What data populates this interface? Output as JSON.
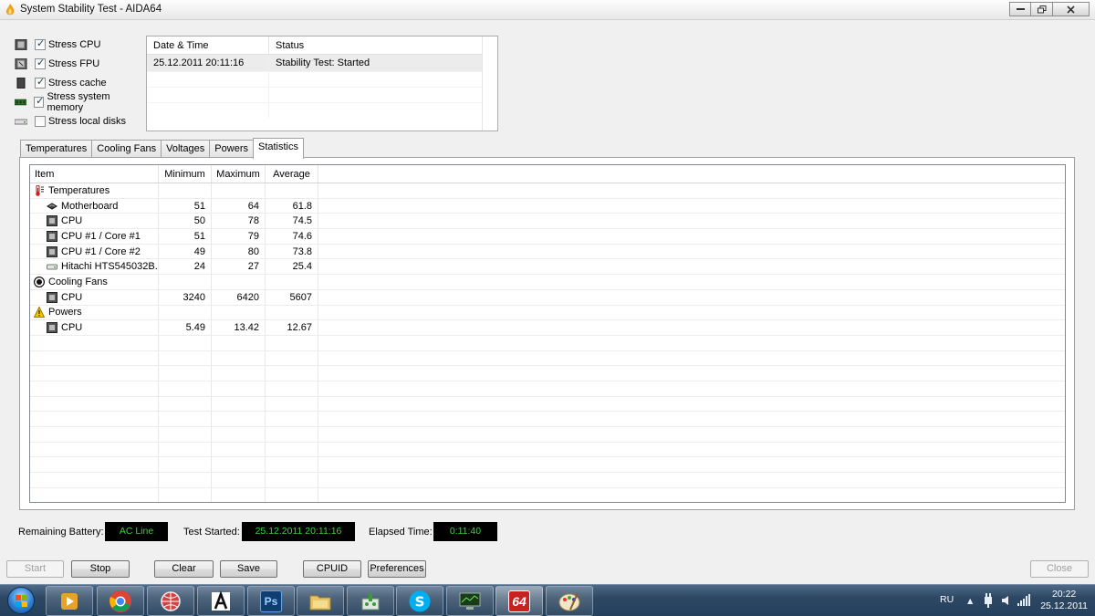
{
  "window": {
    "title": "System Stability Test - AIDA64",
    "controls": [
      "minimize",
      "maximize",
      "close"
    ]
  },
  "stress_options": [
    {
      "label": "Stress CPU",
      "checked": true,
      "icon": "cpu-chip-icon"
    },
    {
      "label": "Stress FPU",
      "checked": true,
      "icon": "fpu-chip-icon"
    },
    {
      "label": "Stress cache",
      "checked": true,
      "icon": "cache-chip-icon"
    },
    {
      "label": "Stress system memory",
      "checked": true,
      "icon": "memory-module-icon"
    },
    {
      "label": "Stress local disks",
      "checked": false,
      "icon": "hard-disk-icon"
    }
  ],
  "log": {
    "headers": {
      "datetime": "Date & Time",
      "status": "Status"
    },
    "rows": [
      {
        "datetime": "25.12.2011 20:11:16",
        "status": "Stability Test: Started"
      }
    ]
  },
  "tabs": [
    {
      "label": "Temperatures",
      "active": false
    },
    {
      "label": "Cooling Fans",
      "active": false
    },
    {
      "label": "Voltages",
      "active": false
    },
    {
      "label": "Powers",
      "active": false
    },
    {
      "label": "Statistics",
      "active": true
    }
  ],
  "stats": {
    "headers": {
      "item": "Item",
      "min": "Minimum",
      "max": "Maximum",
      "avg": "Average"
    },
    "rows": [
      {
        "level": 0,
        "icon": "thermometer-icon",
        "item": "Temperatures",
        "min": "",
        "max": "",
        "avg": ""
      },
      {
        "level": 1,
        "icon": "motherboard-icon",
        "item": "Motherboard",
        "min": "51",
        "max": "64",
        "avg": "61.8"
      },
      {
        "level": 1,
        "icon": "cpu-chip-icon",
        "item": "CPU",
        "min": "50",
        "max": "78",
        "avg": "74.5"
      },
      {
        "level": 1,
        "icon": "cpu-chip-icon",
        "item": "CPU #1 / Core #1",
        "min": "51",
        "max": "79",
        "avg": "74.6"
      },
      {
        "level": 1,
        "icon": "cpu-chip-icon",
        "item": "CPU #1 / Core #2",
        "min": "49",
        "max": "80",
        "avg": "73.8"
      },
      {
        "level": 1,
        "icon": "hard-disk-icon",
        "item": "Hitachi HTS545032B...",
        "min": "24",
        "max": "27",
        "avg": "25.4"
      },
      {
        "level": 0,
        "icon": "fan-icon",
        "item": "Cooling Fans",
        "min": "",
        "max": "",
        "avg": ""
      },
      {
        "level": 1,
        "icon": "cpu-chip-icon",
        "item": "CPU",
        "min": "3240",
        "max": "6420",
        "avg": "5607"
      },
      {
        "level": 0,
        "icon": "warning-icon",
        "item": "Powers",
        "min": "",
        "max": "",
        "avg": ""
      },
      {
        "level": 1,
        "icon": "cpu-chip-icon",
        "item": "CPU",
        "min": "5.49",
        "max": "13.42",
        "avg": "12.67"
      }
    ],
    "empty_rows": 11
  },
  "status": {
    "battery_label": "Remaining Battery:",
    "battery_value": "AC Line",
    "started_label": "Test Started:",
    "started_value": "25.12.2011 20:11:16",
    "elapsed_label": "Elapsed Time:",
    "elapsed_value": "0:11:40",
    "lcd_text_color": "#3cd43c"
  },
  "buttons": {
    "start": "Start",
    "stop": "Stop",
    "clear": "Clear",
    "save": "Save",
    "cpuid": "CPUID",
    "preferences": "Preferences",
    "close": "Close"
  },
  "taskbar": {
    "apps": [
      {
        "name": "media-player-icon",
        "active": false
      },
      {
        "name": "chrome-icon",
        "active": false
      },
      {
        "name": "network-globe-icon",
        "active": false
      },
      {
        "name": "font-viewer-icon",
        "active": false
      },
      {
        "name": "photoshop-icon",
        "active": false
      },
      {
        "name": "file-explorer-icon",
        "active": false
      },
      {
        "name": "network-tool-icon",
        "active": false
      },
      {
        "name": "skype-icon",
        "active": false
      },
      {
        "name": "monitor-tool-icon",
        "active": false
      },
      {
        "name": "aida64-icon",
        "active": true
      },
      {
        "name": "paint-icon",
        "active": false
      }
    ],
    "tray": {
      "language": "RU",
      "time": "20:22",
      "date": "25.12.2011"
    }
  },
  "colors": {
    "taskbar": "#2e4864",
    "lcd_background": "#000000",
    "lcd_text": "#3cd43c"
  }
}
